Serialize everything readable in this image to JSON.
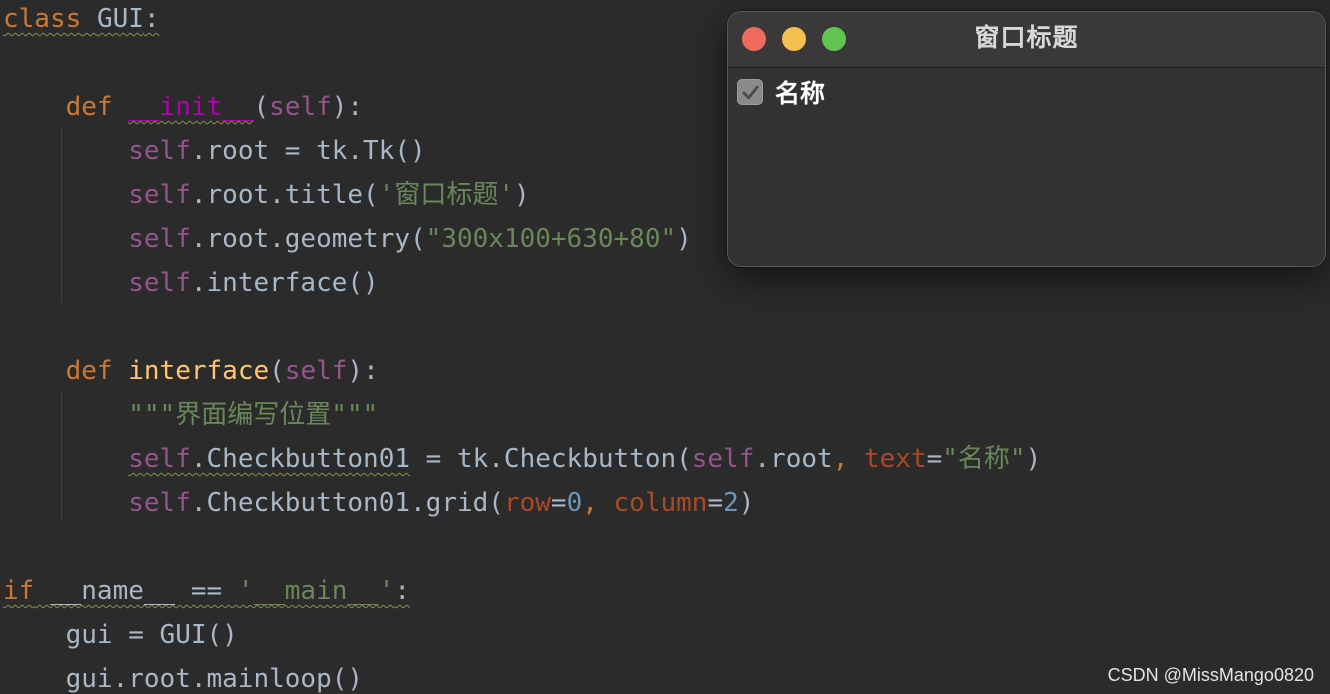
{
  "editor": {
    "lines": {
      "l1": {
        "kw": "class",
        "name": "GUI",
        "colon": ":"
      },
      "l3": {
        "kw": "def",
        "fn": "__init__",
        "open": "(",
        "self": "self",
        "close": "):"
      },
      "l4": {
        "self": "self",
        "rest": ".root = tk.Tk()"
      },
      "l5": {
        "self": "self",
        "mid": ".root.title(",
        "str": "'窗口标题'",
        "close": ")"
      },
      "l6": {
        "self": "self",
        "mid": ".root.geometry(",
        "str": "\"300x100+630+80\"",
        "close": ")"
      },
      "l7": {
        "self": "self",
        "rest": ".interface()"
      },
      "l9": {
        "kw": "def",
        "fn": "interface",
        "open": "(",
        "self": "self",
        "close": "):"
      },
      "l10": {
        "str": "\"\"\"界面编写位置\"\"\""
      },
      "l11": {
        "self": "self",
        "mid": ".Checkbutton01 = tk.Checkbutton(",
        "self2": "self",
        "mid2": ".root, ",
        "param": "text",
        "eq": "=",
        "str": "\"名称\"",
        "close": ")"
      },
      "l12": {
        "self": "self",
        "mid": ".Checkbutton01.grid(",
        "param1": "row",
        "eq1": "=",
        "num1": "0",
        "comma": ", ",
        "param2": "column",
        "eq2": "=",
        "num2": "2",
        "close": ")"
      },
      "l14": {
        "kw": "if",
        "mid": " __name__ == ",
        "str": "'__main__'",
        "colon": ":"
      },
      "l15": {
        "rest": "gui = GUI()"
      },
      "l16": {
        "rest": "gui.root.mainloop()"
      }
    }
  },
  "tk_window": {
    "title": "窗口标题",
    "checkbutton": {
      "label": "名称",
      "checked": true
    }
  },
  "watermark": "CSDN @MissMango0820",
  "colors": {
    "editor_bg": "#2b2b2b",
    "keyword": "#cc7832",
    "self": "#94558d",
    "string": "#6a8759",
    "function": "#ffc66d",
    "number": "#6897bb",
    "param": "#aa4926",
    "close_button": "#ed6a5e",
    "minimize_button": "#f5bf4f",
    "zoom_button": "#61c554"
  }
}
